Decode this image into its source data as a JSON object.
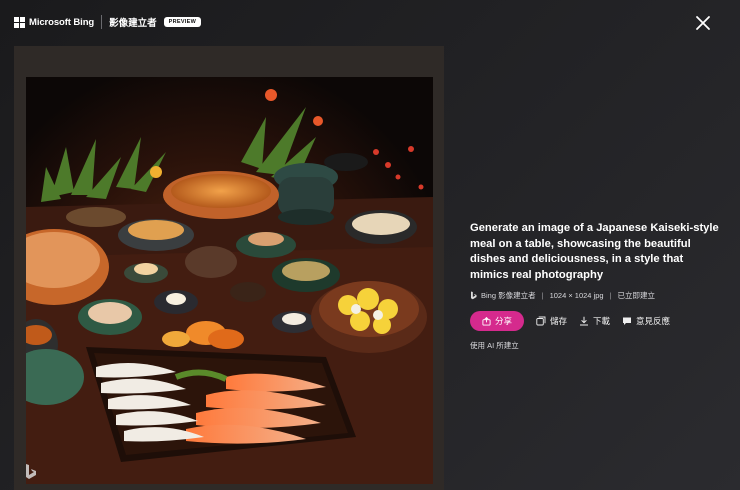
{
  "header": {
    "brand": "Microsoft Bing",
    "product": "影像建立者",
    "badge": "PREVIEW"
  },
  "icons": {
    "close": "close-icon",
    "share": "share-icon",
    "save": "collection-icon",
    "download": "download-icon",
    "feedback": "feedback-icon"
  },
  "image": {
    "alt": "Japanese Kaiseki-style meal on a table"
  },
  "details": {
    "prompt": "Generate an image of a Japanese Kaiseki-style meal on a table, showcasing the beautiful dishes and deliciousness, in a style that mimics real photography",
    "creator": "Bing 影像建立者",
    "dimensions": "1024 × 1024 jpg",
    "status": "已立即建立",
    "made_with": "使用 AI 所建立"
  },
  "actions": {
    "share": "分享",
    "save": "儲存",
    "download": "下載",
    "feedback": "意見反應"
  },
  "colors": {
    "share_button": "#d52a8d",
    "background": "#1f1f22"
  }
}
